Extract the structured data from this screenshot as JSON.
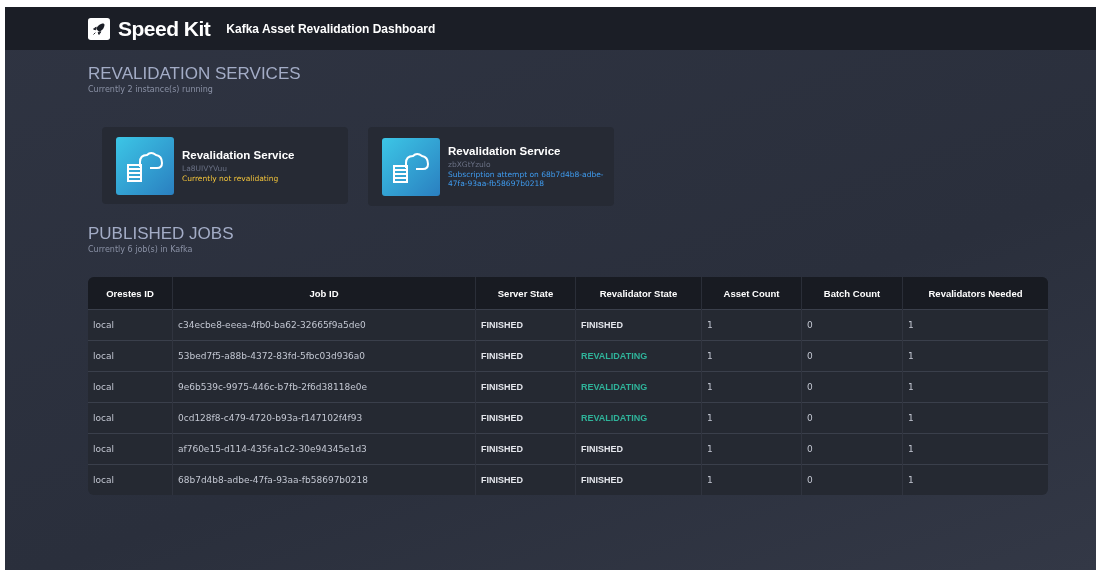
{
  "header": {
    "brand": "Speed Kit",
    "title": "Kafka Asset Revalidation Dashboard"
  },
  "services_section": {
    "heading": "REVALIDATION SERVICES",
    "subtitle": "Currently 2 instance(s) running",
    "services": [
      {
        "name": "Revalidation Service",
        "id": "La8UIVYVuu",
        "status": "Currently not revalidating",
        "kind": "idle"
      },
      {
        "name": "Revalidation Service",
        "id": "zbXGtYzulo",
        "status": "Subscription attempt on 68b7d4b8-adbe-47fa-93aa-fb58697b0218",
        "kind": "subscribing"
      }
    ]
  },
  "jobs_section": {
    "heading": "PUBLISHED JOBS",
    "subtitle": "Currently 6 job(s) in Kafka",
    "table": {
      "columns": [
        "Orestes ID",
        "Job ID",
        "Server State",
        "Revalidator State",
        "Asset Count",
        "Batch Count",
        "Revalidators Needed"
      ],
      "rows": [
        {
          "orestes_id": "local",
          "job_id": "c34ecbe8-eeea-4fb0-ba62-32665f9a5de0",
          "server_state": "FINISHED",
          "revalidator_state": "FINISHED",
          "kind": "finished",
          "asset_count": "1",
          "batch_count": "0",
          "revalidators_needed": "1"
        },
        {
          "orestes_id": "local",
          "job_id": "53bed7f5-a88b-4372-83fd-5fbc03d936a0",
          "server_state": "FINISHED",
          "revalidator_state": "REVALIDATING",
          "kind": "revalidating",
          "asset_count": "1",
          "batch_count": "0",
          "revalidators_needed": "1"
        },
        {
          "orestes_id": "local",
          "job_id": "9e6b539c-9975-446c-b7fb-2f6d38118e0e",
          "server_state": "FINISHED",
          "revalidator_state": "REVALIDATING",
          "kind": "revalidating",
          "asset_count": "1",
          "batch_count": "0",
          "revalidators_needed": "1"
        },
        {
          "orestes_id": "local",
          "job_id": "0cd128f8-c479-4720-b93a-f147102f4f93",
          "server_state": "FINISHED",
          "revalidator_state": "REVALIDATING",
          "kind": "revalidating",
          "asset_count": "1",
          "batch_count": "0",
          "revalidators_needed": "1"
        },
        {
          "orestes_id": "local",
          "job_id": "af760e15-d114-435f-a1c2-30e94345e1d3",
          "server_state": "FINISHED",
          "revalidator_state": "FINISHED",
          "kind": "finished",
          "asset_count": "1",
          "batch_count": "0",
          "revalidators_needed": "1"
        },
        {
          "orestes_id": "local",
          "job_id": "68b7d4b8-adbe-47fa-93aa-fb58697b0218",
          "server_state": "FINISHED",
          "revalidator_state": "FINISHED",
          "kind": "finished",
          "asset_count": "1",
          "batch_count": "0",
          "revalidators_needed": "1"
        }
      ]
    }
  }
}
